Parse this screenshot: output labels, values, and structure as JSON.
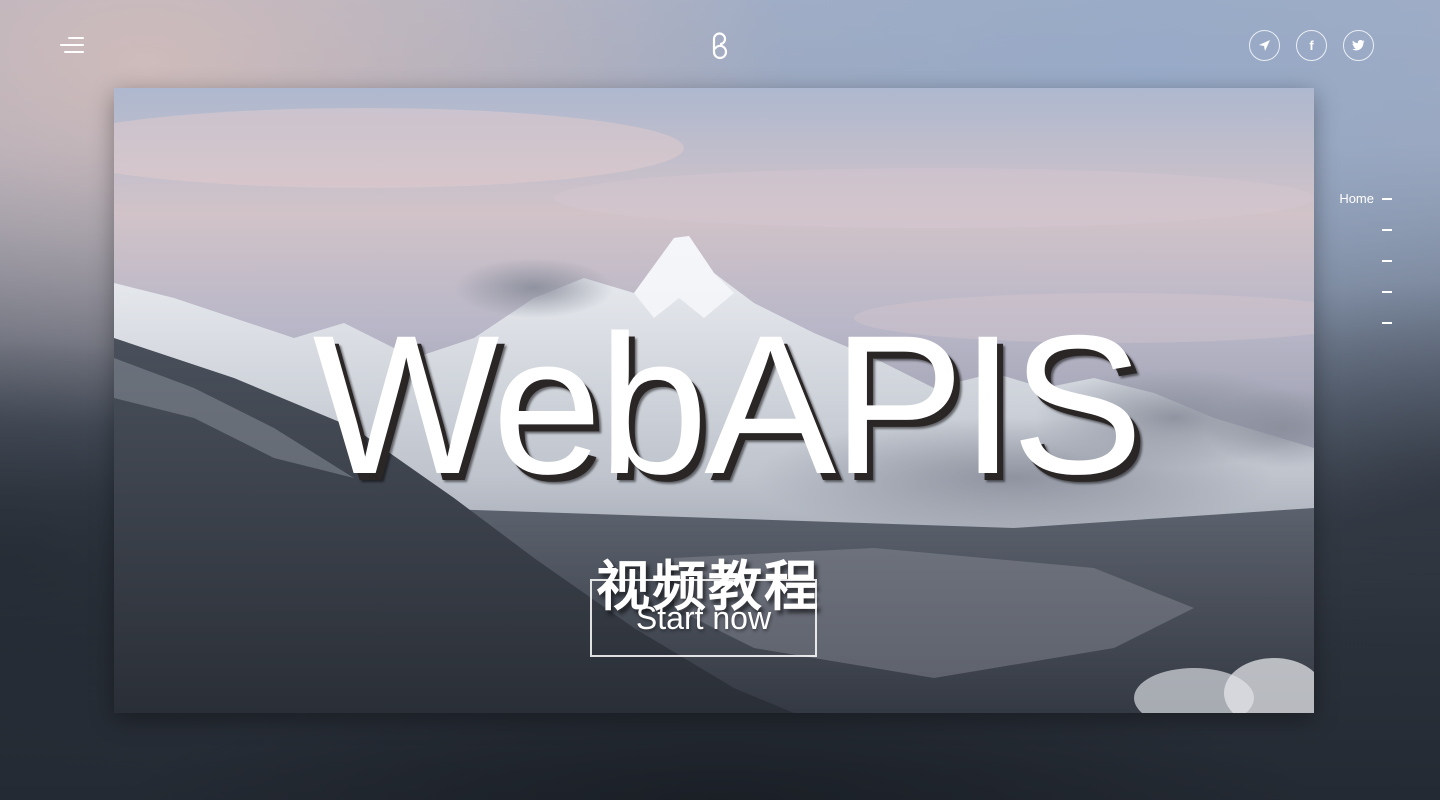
{
  "header": {
    "menu_icon": "hamburger-menu-icon",
    "logo_icon": "brand-logo-icon",
    "social": [
      {
        "name": "send-icon",
        "glyph": "➤"
      },
      {
        "name": "facebook-icon",
        "glyph": "f"
      },
      {
        "name": "twitter-icon",
        "glyph": "🐦"
      }
    ]
  },
  "side_nav": {
    "items": [
      {
        "label": "Home"
      },
      {
        "label": ""
      },
      {
        "label": ""
      },
      {
        "label": ""
      },
      {
        "label": ""
      }
    ]
  },
  "hero": {
    "title": "WebAPIS",
    "subtitle": "视频教程",
    "button_label": "Start now"
  }
}
